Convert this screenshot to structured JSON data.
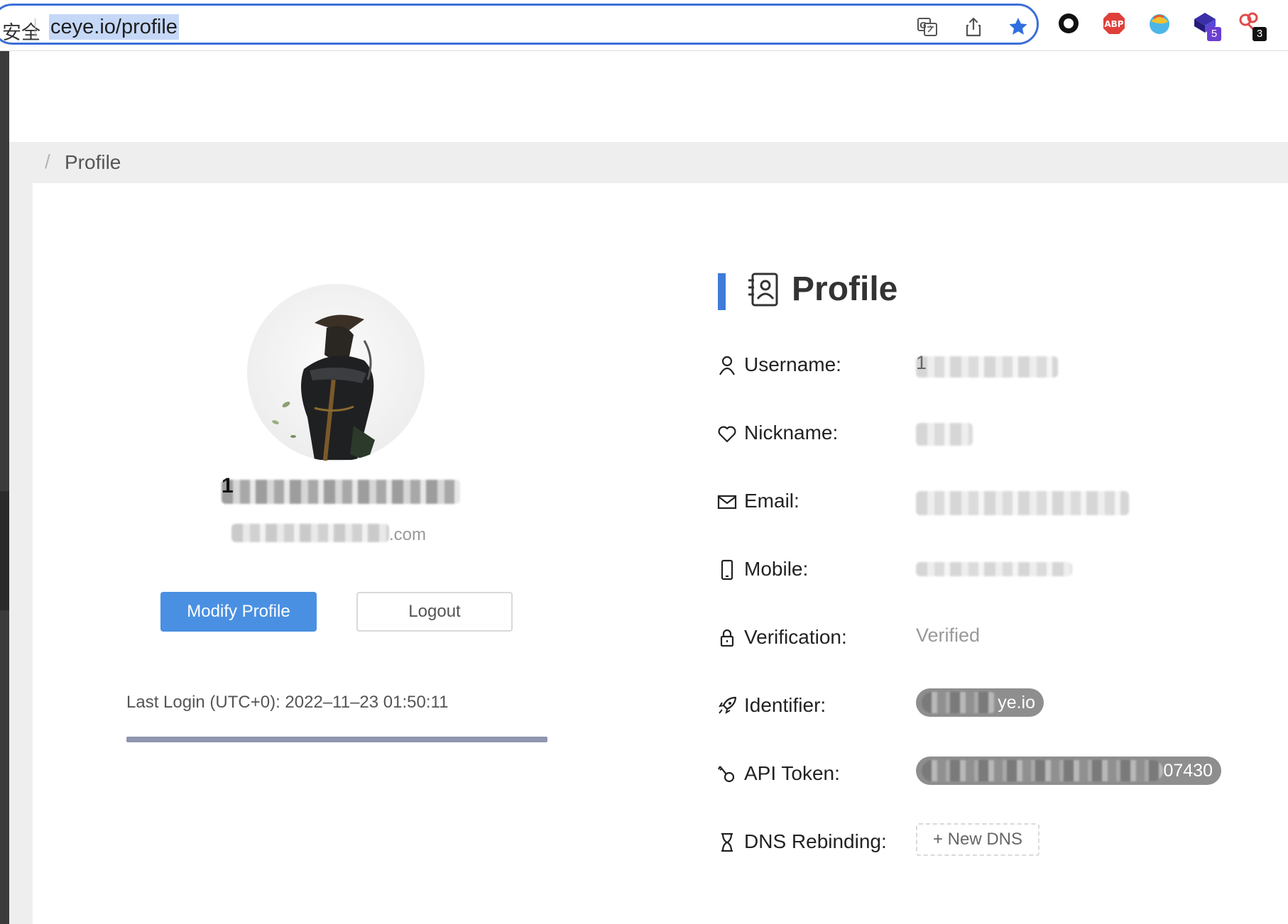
{
  "browser": {
    "security_label": "安全",
    "url": "ceye.io/profile",
    "extensions": [
      {
        "name": "circle-extension-icon"
      },
      {
        "name": "adblock-plus-icon",
        "label": "ABP"
      },
      {
        "name": "globe-extension-icon"
      },
      {
        "name": "cube-extension-icon",
        "badge": "5",
        "badge_color": "#6b3fd1"
      },
      {
        "name": "key-extension-icon",
        "badge": "3",
        "badge_color": "#111111"
      }
    ]
  },
  "breadcrumb": {
    "separator": "/",
    "current": "Profile"
  },
  "user_card": {
    "title_visible": "1",
    "subtitle_visible": ".com",
    "modify_label": "Modify Profile",
    "logout_label": "Logout",
    "last_login": "Last Login (UTC+0): 2022–11–23 01:50:11",
    "progress_percent": 100
  },
  "profile": {
    "heading": "Profile",
    "rows": [
      {
        "icon": "user-icon",
        "label": "Username:",
        "value_visible": "1",
        "blurred": true
      },
      {
        "icon": "heart-icon",
        "label": "Nickname:",
        "value_visible": "",
        "blurred": true
      },
      {
        "icon": "mail-icon",
        "label": "Email:",
        "value_visible": "",
        "blurred": true
      },
      {
        "icon": "mobile-icon",
        "label": "Mobile:",
        "value_visible": "",
        "blurred": true
      },
      {
        "icon": "lock-icon",
        "label": "Verification:",
        "value": "Verified"
      },
      {
        "icon": "rocket-icon",
        "label": "Identifier:",
        "value_visible": "ye.io",
        "pill": true
      },
      {
        "icon": "key-icon",
        "label": "API Token:",
        "value_visible": "07430",
        "pill": true
      },
      {
        "icon": "hourglass-icon",
        "label": "DNS Rebinding:",
        "button_label": "+ New DNS"
      }
    ]
  },
  "colors": {
    "primary": "#4a90e2",
    "accent_bar": "#3f7bd9",
    "omnibox_border": "#3b6fd8"
  }
}
